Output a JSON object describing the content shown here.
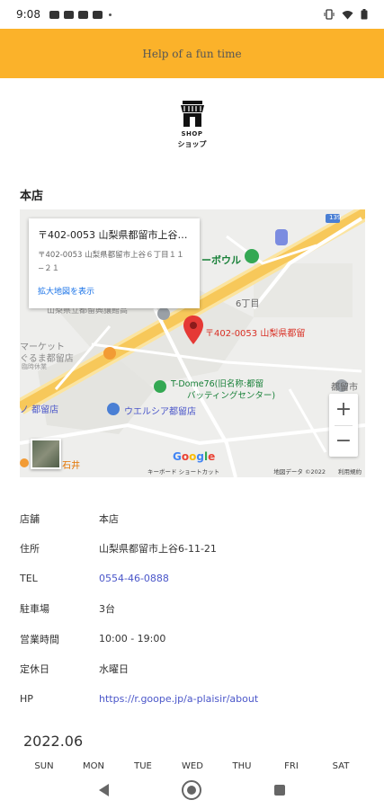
{
  "status_bar": {
    "time": "9:08"
  },
  "header": {
    "title": "Help of a fun time"
  },
  "shop_logo": {
    "label_en": "SHOP",
    "label_jp": "ショップ"
  },
  "section": {
    "title": "本店"
  },
  "map": {
    "card_title": "〒402-0053 山梨県都留市上谷…",
    "card_address": "〒402-0053 山梨県都留市上谷６丁目１１−２１",
    "card_link": "拡大地図を表示",
    "marker_label": "〒402-0053 山梨県都留",
    "labels": {
      "bowl": "ーボウル",
      "chome": "6丁目",
      "hall": "山梨県立都留興讓館高",
      "market": "マーケット",
      "tsuru_store": "ぐるま都留店",
      "closed": "臨時休業",
      "tdome": "T-Dome76(旧名称:都留",
      "batting": "バッティングセンター)",
      "welcia": "ウエルシア都留店",
      "tsuru_shop": "ノ 都留店",
      "tsuru_city": "都留市",
      "udon": "うどん 石井",
      "route": "139"
    },
    "zoom_in": "+",
    "zoom_out": "−",
    "google": "Google",
    "shortcuts": "キーボード ショートカット",
    "map_data": "地図データ ©2022",
    "terms": "利用規約"
  },
  "info": [
    {
      "label": "店舗",
      "value": "本店",
      "link": false
    },
    {
      "label": "住所",
      "value": "山梨県都留市上谷6-11-21",
      "link": false
    },
    {
      "label": "TEL",
      "value": "0554-46-0888",
      "link": true
    },
    {
      "label": "駐車場",
      "value": "3台",
      "link": false
    },
    {
      "label": "営業時間",
      "value": "10:00 - 19:00",
      "link": false
    },
    {
      "label": "定休日",
      "value": "水曜日",
      "link": false
    },
    {
      "label": "HP",
      "value": "https://r.goope.jp/a-plaisir/about",
      "link": true
    }
  ],
  "calendar": {
    "month": "2022.06",
    "weekdays": [
      "SUN",
      "MON",
      "TUE",
      "WED",
      "THU",
      "FRI",
      "SAT"
    ]
  },
  "colors": {
    "header": "#fbb22a",
    "link": "#4a56c9",
    "marker": "#e53935"
  }
}
